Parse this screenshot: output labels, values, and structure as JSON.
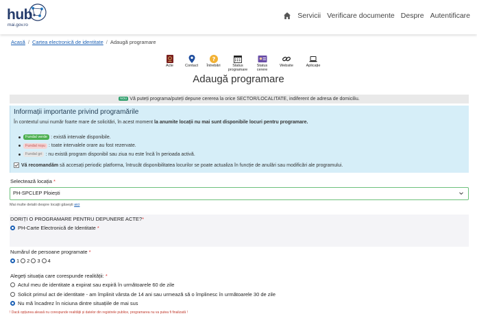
{
  "header": {
    "logo_text": "hub",
    "logo_domain": "mai.gov.ro",
    "nav": [
      "Servicii",
      "Verificare documente",
      "Despre",
      "Autentificare"
    ]
  },
  "breadcrumb": [
    "Acasă",
    "Cartea electronică de identitate",
    "Adaugă programare"
  ],
  "quick_links": [
    {
      "label": "Acte",
      "icon": "passport-icon"
    },
    {
      "label": "Contact",
      "icon": "map-pin-icon"
    },
    {
      "label": "Întrebări",
      "icon": "question-icon"
    },
    {
      "label": "Status\nprogramare",
      "icon": "calendar-icon"
    },
    {
      "label": "Status\ncerere",
      "icon": "id-card-icon"
    },
    {
      "label": "Website",
      "icon": "link-icon"
    },
    {
      "label": "Aplicație",
      "icon": "laptop-icon"
    }
  ],
  "page_title": "Adaugă programare",
  "notice": {
    "badge": "NOU",
    "text": "Vă puteți programa/puteți depune cererea la orice SECTOR/LOCALITATE, indiferent de adresa de domiciliu."
  },
  "info": {
    "title": "Informații importante privind programările",
    "p1_start": "În contextul unui număr foarte mare de solicitări, în acest moment ",
    "p1_bold": "la anumite locații nu mai sunt disponibile locuri pentru programare.",
    "legend": [
      {
        "chip": "Fundal verde",
        "text": ": există intervale disponibile."
      },
      {
        "chip": "Fundal roșu",
        "text": ": toate intervalele orare au fost rezervate."
      },
      {
        "chip": "Fundal gri",
        "text": ": nu există program disponibil sau ziua nu este încă în perioada activă."
      }
    ],
    "p2_bold": "Vă recomandăm",
    "p2_rest": " să accesați periodic platforma, întrucât disponibilitatea locurilor se poate actualiza în funcție de anulări sau modificări ale programului."
  },
  "location": {
    "label": "Selectează locația",
    "value": "PH-SPCLEP Ploiești",
    "hint_text": "Mai multe detalii despre locații găsești ",
    "hint_link": "aici"
  },
  "act": {
    "question": "DORIȚI O PROGRAMARE PENTRU DEPUNERE ACTE?",
    "option": "PH-Carte Electronică de Identitate"
  },
  "persons": {
    "label": "Numărul de persoane programate",
    "options": [
      "1",
      "2",
      "3",
      "4"
    ],
    "selected": "1"
  },
  "situation": {
    "label": "Alegeți situația care corespunde realității:",
    "options": [
      "Actul meu de identitate a expirat sau expiră în următoarele 60 de zile",
      "Solicit primul act de identitate - am împlinit vârsta de 14 ani sau urmează să o împlinesc în următoarele 30 de zile",
      "Nu mă încadrez în niciuna dintre situațiile de mai sus"
    ],
    "selected_index": 2
  },
  "warning": "! Dacă opțiunea aleasă nu corespunde realității și datelor din registrele publice, programarea nu va putea fi finalizată !",
  "colors": {
    "accent": "#1a5fb4",
    "info_bg": "#d6eef8",
    "required": "#dd3333",
    "select_border": "#6cc07a"
  }
}
